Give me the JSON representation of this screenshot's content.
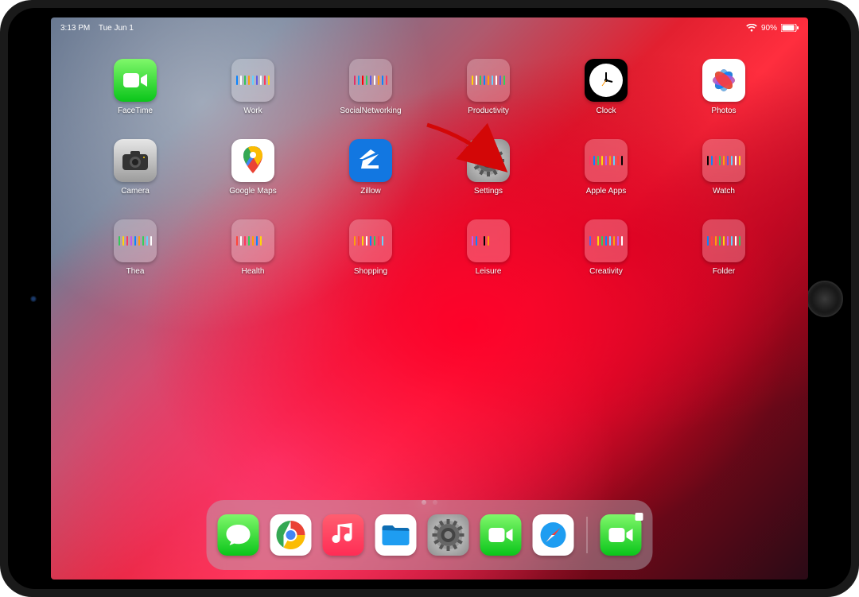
{
  "status": {
    "time": "3:13 PM",
    "date": "Tue Jun 1",
    "battery_pct": "90%",
    "wifi_icon": "wifi-icon",
    "battery_icon": "battery-icon"
  },
  "annotation": {
    "arrow_points_to": "Settings",
    "arrow_color": "#d30707"
  },
  "home": {
    "rows": [
      [
        {
          "id": "facetime",
          "label": "FaceTime",
          "kind": "app"
        },
        {
          "id": "work",
          "label": "Work",
          "kind": "folder"
        },
        {
          "id": "socialnetworking",
          "label": "SocialNetworking",
          "kind": "folder"
        },
        {
          "id": "productivity",
          "label": "Productivity",
          "kind": "folder"
        },
        {
          "id": "clock",
          "label": "Clock",
          "kind": "app"
        },
        {
          "id": "photos",
          "label": "Photos",
          "kind": "app"
        }
      ],
      [
        {
          "id": "camera",
          "label": "Camera",
          "kind": "app"
        },
        {
          "id": "googlemaps",
          "label": "Google Maps",
          "kind": "app"
        },
        {
          "id": "zillow",
          "label": "Zillow",
          "kind": "app"
        },
        {
          "id": "settings",
          "label": "Settings",
          "kind": "app"
        },
        {
          "id": "appleapps",
          "label": "Apple Apps",
          "kind": "folder"
        },
        {
          "id": "watch",
          "label": "Watch",
          "kind": "folder"
        }
      ],
      [
        {
          "id": "thea",
          "label": "Thea",
          "kind": "folder"
        },
        {
          "id": "health",
          "label": "Health",
          "kind": "folder"
        },
        {
          "id": "shopping",
          "label": "Shopping",
          "kind": "folder"
        },
        {
          "id": "leisure",
          "label": "Leisure",
          "kind": "folder"
        },
        {
          "id": "creativity",
          "label": "Creativity",
          "kind": "folder"
        },
        {
          "id": "folder",
          "label": "Folder",
          "kind": "folder"
        }
      ]
    ]
  },
  "pages": {
    "count": 2,
    "active": 0
  },
  "dock": {
    "pinned": [
      {
        "id": "messages",
        "name": "Messages"
      },
      {
        "id": "chrome",
        "name": "Chrome"
      },
      {
        "id": "music",
        "name": "Music"
      },
      {
        "id": "files",
        "name": "Files"
      },
      {
        "id": "settings",
        "name": "Settings"
      },
      {
        "id": "facetime",
        "name": "FaceTime"
      },
      {
        "id": "safari",
        "name": "Safari"
      }
    ],
    "recent": [
      {
        "id": "recent-facetime",
        "name": "FaceTime (recent)"
      }
    ]
  }
}
